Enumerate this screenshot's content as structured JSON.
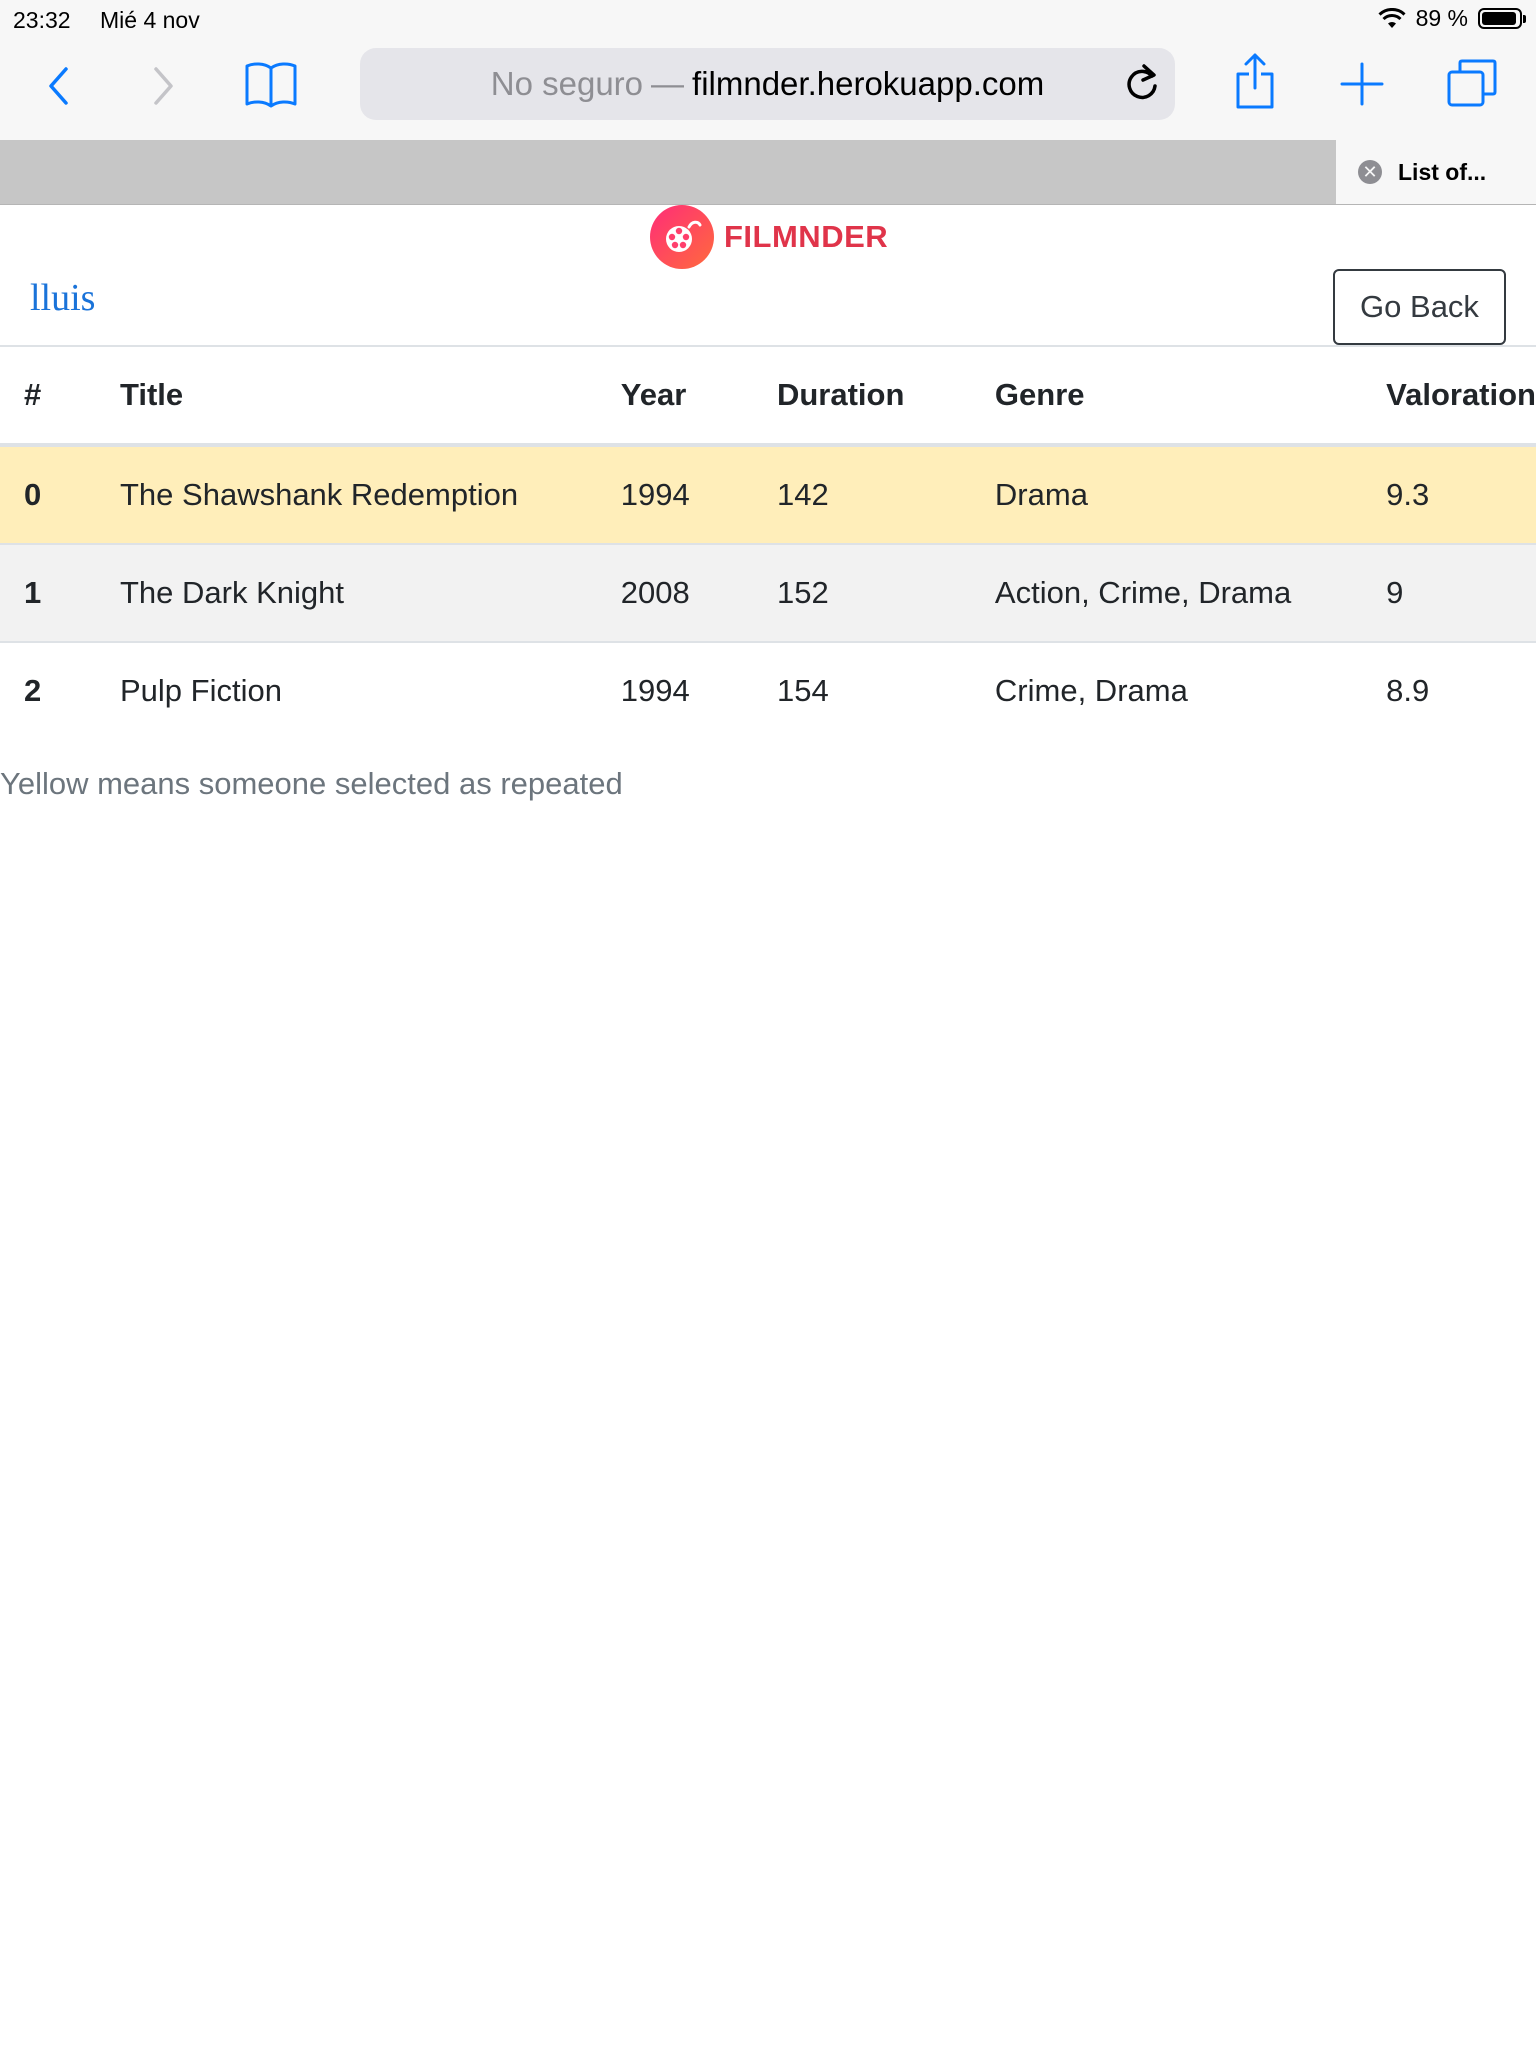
{
  "status_bar": {
    "time": "23:32",
    "date": "Mié 4 nov",
    "battery": "89 %"
  },
  "browser": {
    "address_insecure": "No seguro",
    "address_separator": "—",
    "address_domain": "filmnder.herokuapp.com",
    "tab_title": "List of..."
  },
  "header": {
    "brand": "FILMNDER",
    "user": "lluis",
    "back_label": "Go Back"
  },
  "table": {
    "columns": [
      "#",
      "Title",
      "Year",
      "Duration",
      "Genre",
      "Valoration"
    ],
    "rows": [
      {
        "index": "0",
        "title": "The Shawshank Redemption",
        "year": "1994",
        "duration": "142",
        "genre": "Drama",
        "valoration": "9.3",
        "highlighted": true
      },
      {
        "index": "1",
        "title": "The Dark Knight",
        "year": "2008",
        "duration": "152",
        "genre": "Action, Crime, Drama",
        "valoration": "9",
        "highlighted": false
      },
      {
        "index": "2",
        "title": "Pulp Fiction",
        "year": "1994",
        "duration": "154",
        "genre": "Crime, Drama",
        "valoration": "8.9",
        "highlighted": false
      }
    ]
  },
  "footnote": "Yellow means someone selected as repeated",
  "colors": {
    "highlight": "#ffeeba",
    "brand": "#e0344a",
    "link": "#1a73d9",
    "ios_blue": "#0a7aff"
  },
  "icons": [
    "wifi-icon",
    "battery-icon",
    "back-chevron-icon",
    "forward-chevron-icon",
    "bookmarks-icon",
    "reload-icon",
    "share-icon",
    "new-tab-icon",
    "tabs-icon",
    "tab-close-icon",
    "film-reel-icon"
  ]
}
